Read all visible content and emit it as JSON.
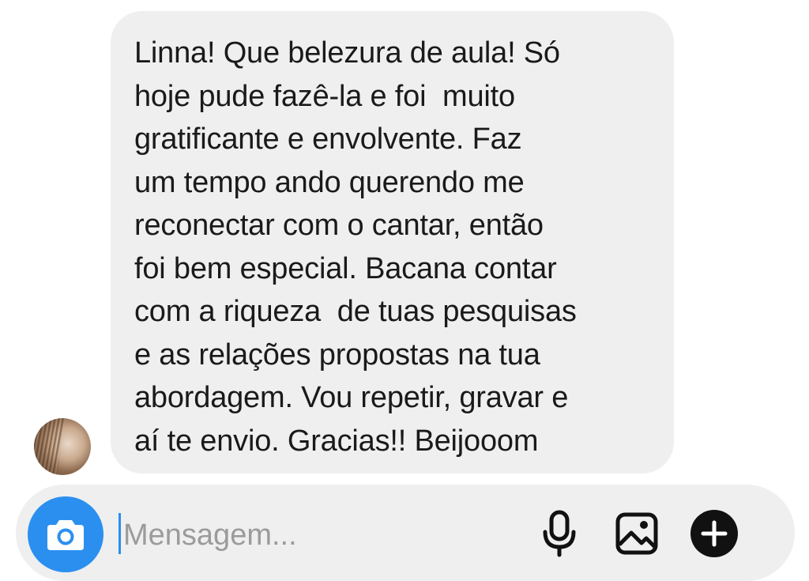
{
  "message": {
    "text": "Linna! Que belezura de aula! Só\nhoje pude fazê-la e foi  muito\ngratificante e envolvente. Faz\num tempo ando querendo me\nreconectar com o cantar, então\nfoi bem especial. Bacana contar\ncom a riqueza  de tuas pesquisas\ne as relações propostas na tua\nabordagem. Vou repetir, gravar e\naí te envio. Gracias!! Beijooom"
  },
  "composer": {
    "placeholder": "Mensagem...",
    "camera_icon": "camera-icon",
    "mic_icon": "microphone-icon",
    "image_icon": "image-icon",
    "plus_icon": "plus-icon"
  },
  "colors": {
    "accent": "#2b8ff0",
    "bubble": "#efefef",
    "text": "#1a1a1a",
    "placeholder": "#9b9b9b"
  }
}
